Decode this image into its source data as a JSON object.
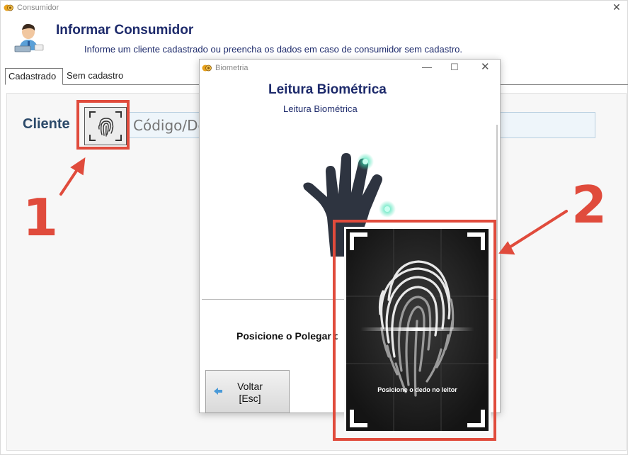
{
  "main_window": {
    "title": "Consumidor",
    "close_glyph": "✕",
    "header_title": "Informar Consumidor",
    "header_subtitle": "Informe um cliente cadastrado ou preencha os dados em caso de consumidor sem cadastro.",
    "tabs": [
      {
        "label": "Cadastrado",
        "active": true
      },
      {
        "label": "Sem cadastro",
        "active": false
      }
    ],
    "cliente_label": "Cliente",
    "cliente_placeholder": "Código/Descrição"
  },
  "biometria_dialog": {
    "title": "Biometria",
    "min_glyph": "—",
    "max_glyph": "☐",
    "close_glyph": "✕",
    "heading": "Leitura Biométrica",
    "subheading": "Leitura Biométrica",
    "instruction": "Posicione o Polegar d",
    "back_button_line1": "Voltar",
    "back_button_line2": "[Esc]"
  },
  "scanner": {
    "caption": "Posicione o dedo no leitor"
  },
  "annotations": {
    "number_1": "1",
    "number_2": "2",
    "color": "#e04b3c"
  },
  "icons": [
    "app-logo-icon",
    "user-avatar-icon",
    "fingerprint-icon",
    "hand-icon",
    "back-arrow-icon"
  ],
  "colors": {
    "title_navy": "#1d2a6b",
    "label_blue": "#2c4a6a",
    "input_bg": "#eef5fa",
    "annotation_red": "#e04b3c",
    "scanner_glow": "#38e0b0"
  }
}
